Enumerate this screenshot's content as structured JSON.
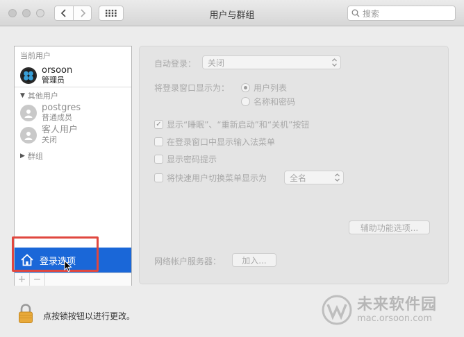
{
  "window": {
    "title": "用户与群组",
    "search_placeholder": "搜索"
  },
  "sidebar": {
    "current_users_label": "当前用户",
    "current_user": {
      "name": "orsoon",
      "role": "管理员"
    },
    "other_users_label": "其他用户",
    "other_users": [
      {
        "name": "postgres",
        "role": "普通成员"
      },
      {
        "name": "客人用户",
        "role": "关闭"
      }
    ],
    "groups_label": "群组",
    "login_options_label": "登录选项",
    "add_label": "+",
    "remove_label": "−"
  },
  "panel": {
    "auto_login_label": "自动登录：",
    "auto_login_value": "关闭",
    "display_login_window_label": "将登录窗口显示为：",
    "radio_user_list": "用户列表",
    "radio_name_password": "名称和密码",
    "check_show_buttons": "显示“睡眠”、“重新启动”和“关机”按钮",
    "check_input_menu": "在登录窗口中显示输入法菜单",
    "check_password_hints": "显示密码提示",
    "check_fast_user_switch": "将快速用户切换菜单显示为",
    "fast_user_switch_value": "全名",
    "accessibility_button": "辅助功能选项...",
    "network_server_label": "网络帐户服务器：",
    "join_button": "加入..."
  },
  "footer": {
    "lock_text": "点按锁按钮以进行更改。"
  },
  "watermark": {
    "main": "未来软件园",
    "site": "mac.orsoon.com"
  },
  "colors": {
    "selection": "#1a67d8",
    "highlight_box": "#e0473f"
  }
}
